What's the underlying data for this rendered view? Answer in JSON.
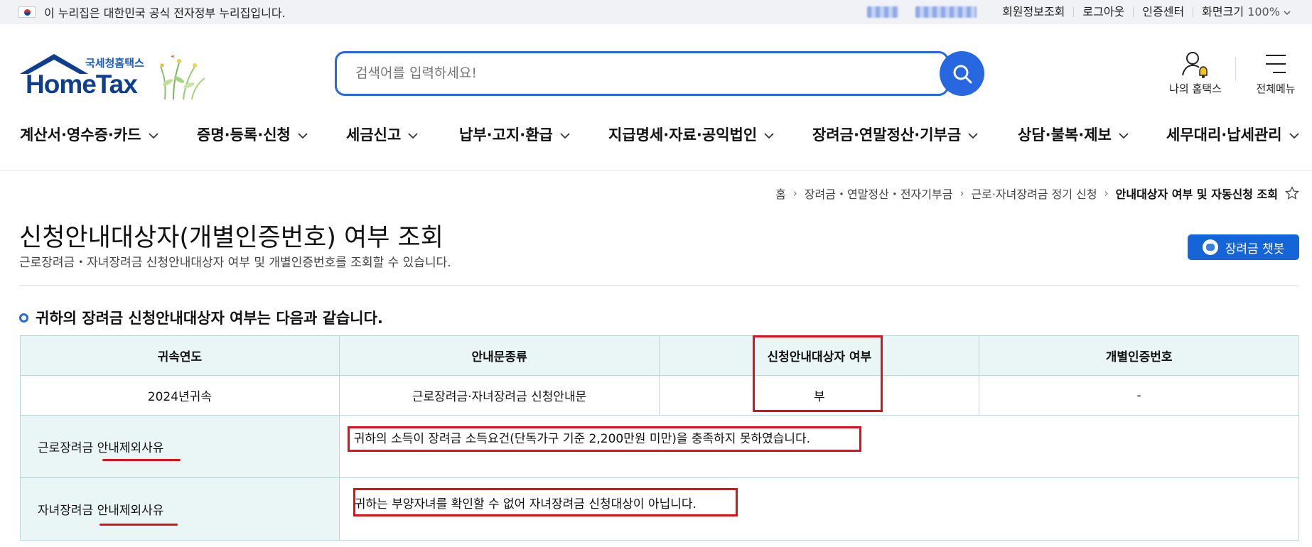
{
  "topbar": {
    "notice": "이 누리집은 대한민국 공식 전자정부 누리집입니다.",
    "links": [
      "회원정보조회",
      "로그아웃",
      "인증센터"
    ],
    "zoom_label": "화면크기",
    "zoom_value": "100%"
  },
  "header": {
    "logo_sub": "국세청홈택스",
    "logo_main": "HomeTax",
    "search_placeholder": "검색어를 입력하세요!",
    "my_hometax": "나의 홈택스",
    "all_menu": "전체메뉴"
  },
  "nav": {
    "items": [
      "계산서·영수증·카드",
      "증명·등록·신청",
      "세금신고",
      "납부·고지·환급",
      "지급명세·자료·공익법인",
      "장려금·연말정산·기부금",
      "상담·불복·제보",
      "세무대리·납세관리"
    ]
  },
  "breadcrumb": {
    "items": [
      "홈",
      "장려금・연말정산・전자기부금",
      "근로·자녀장려금 정기 신청",
      "안내대상자 여부 및 자동신청 조회"
    ]
  },
  "page": {
    "title": "신청안내대상자(개별인증번호) 여부 조회",
    "desc": "근로장려금・자녀장려금 신청안내대상자 여부 및 개별인증번호를 조회할 수 있습니다.",
    "chatbot": "장려금 챗봇",
    "section_title": "귀하의 장려금 신청안내대상자 여부는 다음과 같습니다."
  },
  "table": {
    "headers": [
      "귀속연도",
      "안내문종류",
      "신청안내대상자 여부",
      "개별인증번호"
    ],
    "row": [
      "2024년귀속",
      "근로장려금·자녀장려금 신청안내문",
      "부",
      "-"
    ],
    "work_label": "근로장려금 안내제외사유",
    "work_reason": "귀하의 소득이 장려금 소득요건(단독가구 기준 2,200만원 미만)을 충족하지 못하였습니다.",
    "child_label": "자녀장려금 안내제외사유",
    "child_reason": "귀하는 부양자녀를 확인할 수 없어 자녀장려금 신청대상이 아닙니다."
  },
  "colors": {
    "accent": "#2767e0",
    "highlight": "#e0101a",
    "table_header_bg": "#eaf6f5"
  }
}
